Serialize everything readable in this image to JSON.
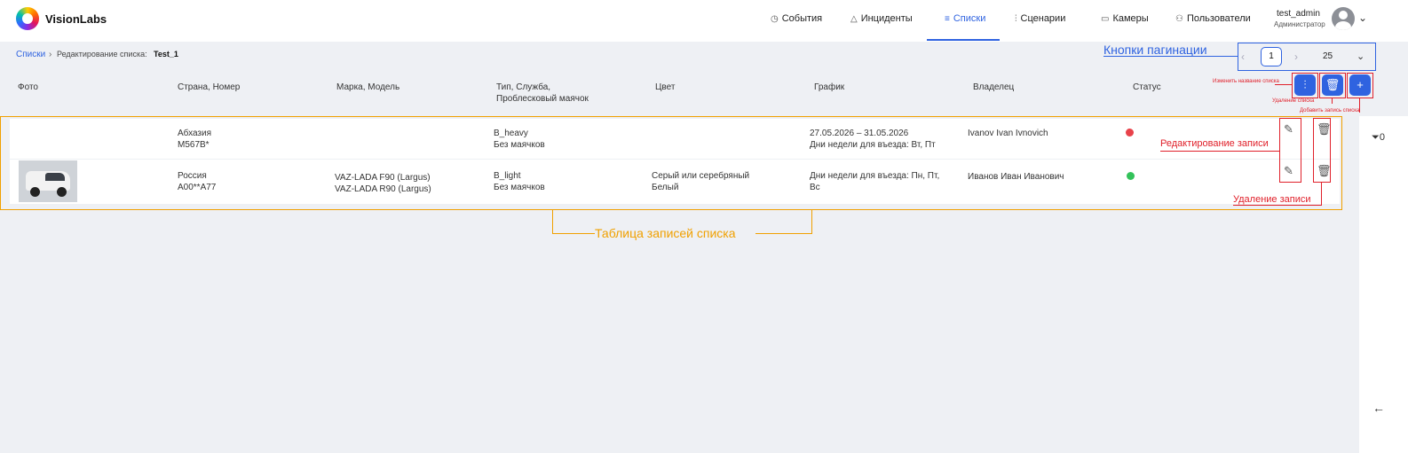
{
  "header": {
    "brand": "VisionLabs",
    "nav": [
      {
        "icon": "clock-icon",
        "glyph": "◷",
        "label": "События"
      },
      {
        "icon": "warning-icon",
        "glyph": "△",
        "label": "Инциденты"
      },
      {
        "icon": "list-icon",
        "glyph": "≡",
        "label": "Списки"
      },
      {
        "icon": "sliders-icon",
        "glyph": "⫶",
        "label": "Сценарии"
      },
      {
        "icon": "camera-icon",
        "glyph": "▭",
        "label": "Камеры"
      },
      {
        "icon": "users-icon",
        "glyph": "⚇",
        "label": "Пользователи"
      }
    ],
    "user": {
      "name": "test_admin",
      "role": "Администратор"
    }
  },
  "breadcrumb": {
    "link": "Списки",
    "separator": "›",
    "text": "Редактирование списка:",
    "list_name": "Test_1"
  },
  "pagination": {
    "annotation": "Кнопки пагинации",
    "page": "1",
    "page_size": "25"
  },
  "columns": [
    "Фото",
    "Страна, Номер",
    "Марка, Модель",
    "Тип, Служба,\nПроблесковый маячок",
    "Цвет",
    "График",
    "Владелец",
    "Статус"
  ],
  "toolbar": {
    "edit_name_annotation": "Изменить название списка",
    "delete_list_annotation": "Удаление списка",
    "add_record_annotation": "Добавить запись списка"
  },
  "rows": [
    {
      "country": "Абхазия",
      "number": "M567B*",
      "make1": "",
      "make2": "",
      "type": "B_heavy",
      "beacon": "Без маячков",
      "color1": "",
      "color2": "",
      "schedule1": "27.05.2026 – 31.05.2026",
      "schedule2": "Дни недели для въезда: Вт, Пт",
      "owner": "Ivanov Ivan Ivnovich",
      "status": "red"
    },
    {
      "country": "Россия",
      "number": "A00**A77",
      "make1": "VAZ-LADA F90 (Largus)",
      "make2": "VAZ-LADA R90 (Largus)",
      "type": "B_light",
      "beacon": "Без маячков",
      "color1": "Серый или серебряный",
      "color2": "Белый",
      "schedule1": "Дни недели для въезда: Пн, Пт,",
      "schedule2": "Вс",
      "owner": "Иванов Иван Иванович",
      "status": "green"
    }
  ],
  "annotations": {
    "edit_record": "Редактирование записи",
    "delete_record": "Удаление записи",
    "table": "Таблица записей списка"
  },
  "side": {
    "filter_count": "0"
  },
  "colors": {
    "accent": "#2f63e0",
    "annotation_red": "#e0202a",
    "annotation_orange": "#f0a000",
    "status_red": "#e8424a",
    "status_green": "#33c25a"
  }
}
